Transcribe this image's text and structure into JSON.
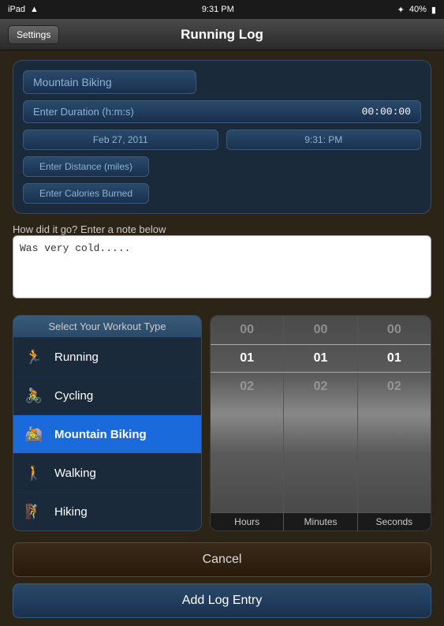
{
  "status_bar": {
    "left": "iPad",
    "time": "9:31 PM",
    "battery": "40%",
    "signal": "WiFi"
  },
  "nav": {
    "title": "Running Log",
    "settings_label": "Settings"
  },
  "top_card": {
    "workout_type": "Mountain Biking",
    "duration_label": "Enter Duration (h:m:s)",
    "duration_value": "00:00:00",
    "date_value": "Feb 27, 2011",
    "time_value": "9:31: PM",
    "distance_placeholder": "Enter Distance (miles)",
    "calories_placeholder": "Enter Calories Burned",
    "note_label": "How did it go?  Enter a note below",
    "note_value": "Was very cold....."
  },
  "workout_selector": {
    "header": "Select Your Workout Type",
    "items": [
      {
        "id": "running",
        "label": "Running",
        "icon": "run",
        "selected": false
      },
      {
        "id": "cycling",
        "label": "Cycling",
        "icon": "cycle",
        "selected": false
      },
      {
        "id": "mountain-biking",
        "label": "Mountain Biking",
        "icon": "mtb",
        "selected": true
      },
      {
        "id": "walking",
        "label": "Walking",
        "icon": "walk",
        "selected": false
      },
      {
        "id": "hiking",
        "label": "Hiking",
        "icon": "hike",
        "selected": false
      }
    ]
  },
  "time_picker": {
    "columns": [
      {
        "label": "Hours",
        "values": [
          "00",
          "01",
          "02"
        ]
      },
      {
        "label": "Minutes",
        "values": [
          "00",
          "01",
          "02"
        ]
      },
      {
        "label": "Seconds",
        "values": [
          "00",
          "01",
          "02"
        ]
      }
    ]
  },
  "buttons": {
    "cancel": "Cancel",
    "add": "Add Log Entry"
  }
}
